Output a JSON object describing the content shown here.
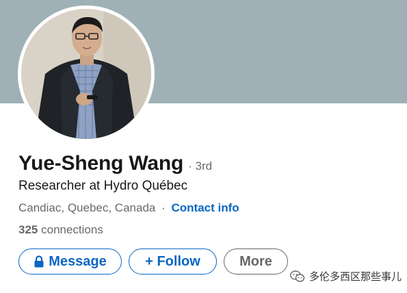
{
  "profile": {
    "name": "Yue-Sheng Wang",
    "degree": "· 3rd",
    "headline": "Researcher at Hydro Québec",
    "location": "Candiac, Quebec, Canada",
    "separator": "·",
    "contact_link": "Contact info",
    "connections_count": "325",
    "connections_label": "connections"
  },
  "actions": {
    "message_label": "Message",
    "follow_label": "+ Follow",
    "more_label": "More"
  },
  "watermark": {
    "text": "多伦多西区那些事儿",
    "icon": "wechat-icon"
  },
  "colors": {
    "cover": "#9fb1b6",
    "link": "#0a66c2",
    "muted": "rgba(0,0,0,0.6)"
  },
  "icons": {
    "message_button": "lock-icon"
  }
}
